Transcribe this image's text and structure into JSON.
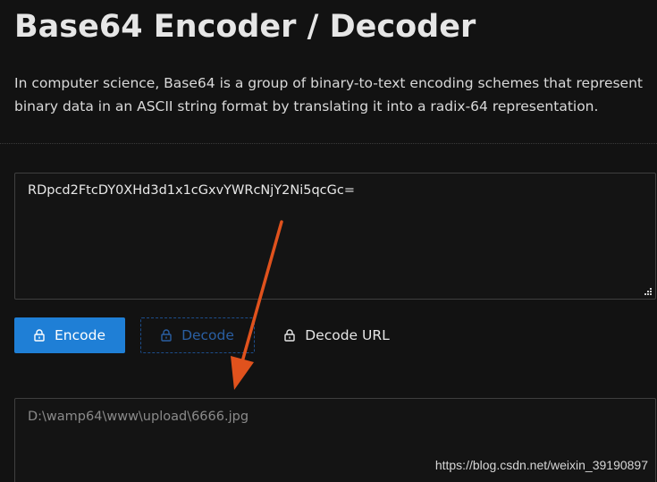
{
  "header": {
    "title": "Base64 Encoder / Decoder",
    "description": "In computer science, Base64 is a group of binary-to-text encoding schemes that represent binary data in an ASCII string format by translating it into a radix-64 representation."
  },
  "input": {
    "value": "RDpcd2FtcDY0XHd3d1x1cGxvYWRcNjY2Ni5qcGc="
  },
  "buttons": {
    "encode_label": "Encode",
    "decode_label": "Decode",
    "decode_url_label": "Decode URL",
    "icon": "lock-icon"
  },
  "output": {
    "value": "D:\\wamp64\\www\\upload\\6666.jpg"
  },
  "watermark": "https://blog.csdn.net/weixin_39190897",
  "colors": {
    "background": "#121212",
    "primary": "#1f7fd6",
    "annotation_arrow": "#e0521d"
  }
}
